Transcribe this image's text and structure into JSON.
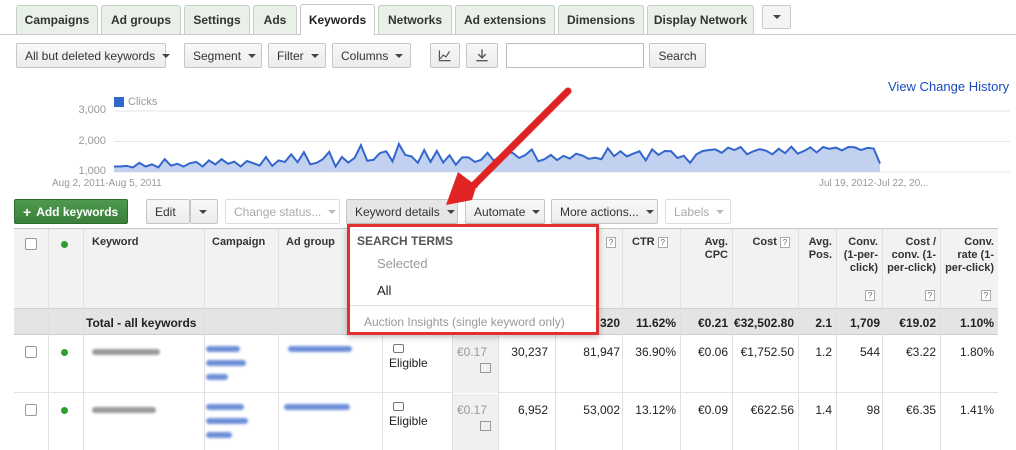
{
  "tabs": [
    "Campaigns",
    "Ad groups",
    "Settings",
    "Ads",
    "Keywords",
    "Networks",
    "Ad extensions",
    "Dimensions",
    "Display Network"
  ],
  "active_tab": "Keywords",
  "toolbar": {
    "filter_select": "All but deleted keywords",
    "segment": "Segment",
    "filter": "Filter",
    "columns": "Columns",
    "search_button": "Search",
    "search_value": ""
  },
  "view_change_history": "View Change History",
  "chart": {
    "legend": "Clicks",
    "y_ticks": [
      "3,000",
      "2,000",
      "1,000"
    ],
    "x_start": "Aug 2, 2011-Aug 5, 2011",
    "x_end": "Jul 19, 2012-Jul 22, 20...",
    "series_color": "#3366cc",
    "values": [
      1180,
      1180,
      1200,
      1150,
      1300,
      1180,
      1250,
      1150,
      1420,
      1210,
      1270,
      1180,
      1290,
      1330,
      1180,
      1380,
      1250,
      1420,
      1270,
      1340,
      1180,
      1360,
      1290,
      1210,
      1490,
      1200,
      1380,
      1330,
      1580,
      1320,
      1650,
      1250,
      1300,
      1420,
      1660,
      1180,
      1490,
      1310,
      1460,
      1880,
      1370,
      1400,
      1620,
      1680,
      1350,
      1920,
      1560,
      1510,
      1300,
      1720,
      1330,
      1690,
      1310,
      1550,
      1240,
      1480,
      1480,
      1330,
      1400,
      1630,
      1370,
      1520,
      1670,
      1620,
      1460,
      1560,
      1740,
      1350,
      1420,
      1560,
      1390,
      1530,
      1440,
      1600,
      1540,
      1430,
      1470,
      1420,
      1780,
      1520,
      1680,
      1510,
      1600,
      1680,
      1380,
      1740,
      1560,
      1690,
      1680,
      1460,
      1530,
      1300,
      1580,
      1690,
      1720,
      1740,
      1630,
      1800,
      1720,
      1820,
      1580,
      1680,
      1750,
      1700,
      1580,
      1760,
      1620,
      1830,
      1600,
      1690,
      1810,
      1640,
      1820,
      1760,
      1800,
      1710,
      1820,
      1810,
      1720,
      1790,
      1770,
      1280
    ]
  },
  "actions": {
    "add_keywords": "Add keywords",
    "edit": "Edit",
    "change_status": "Change status...",
    "keyword_details": "Keyword details",
    "automate": "Automate",
    "more_actions": "More actions...",
    "labels": "Labels"
  },
  "dropdown": {
    "header": "SEARCH TERMS",
    "selected": "Selected",
    "all": "All",
    "auction_insights": "Auction Insights (single keyword only)"
  },
  "columns": {
    "keyword": "Keyword",
    "campaign": "Campaign",
    "ad_group": "Ad group",
    "ctr": "CTR",
    "avg_cpc": "Avg. CPC",
    "cost": "Cost",
    "avg_pos": "Avg. Pos.",
    "conv": "Conv. (1-per-click)",
    "cost_conv": "Cost / conv. (1-per-click)",
    "conv_rate": "Conv. rate (1-per-click)",
    "help": "?"
  },
  "total": {
    "label": "Total - all keywords",
    "impr": "320",
    "ctr": "11.62%",
    "avg_cpc": "€0.21",
    "cost": "€32,502.80",
    "avg_pos": "2.1",
    "conv": "1,709",
    "cost_conv": "€19.02",
    "conv_rate": "1.10%"
  },
  "rows": [
    {
      "status": "Eligible",
      "max_cpc": "€0.17",
      "clicks": "30,237",
      "impr": "81,947",
      "ctr": "36.90%",
      "avg_cpc": "€0.06",
      "cost": "€1,752.50",
      "avg_pos": "1.2",
      "conv": "544",
      "cost_conv": "€3.22",
      "conv_rate": "1.80%"
    },
    {
      "status": "Eligible",
      "max_cpc": "€0.17",
      "clicks": "6,952",
      "impr": "53,002",
      "ctr": "13.12%",
      "avg_cpc": "€0.09",
      "cost": "€622.56",
      "avg_pos": "1.4",
      "conv": "98",
      "cost_conv": "€6.35",
      "conv_rate": "1.41%"
    }
  ]
}
